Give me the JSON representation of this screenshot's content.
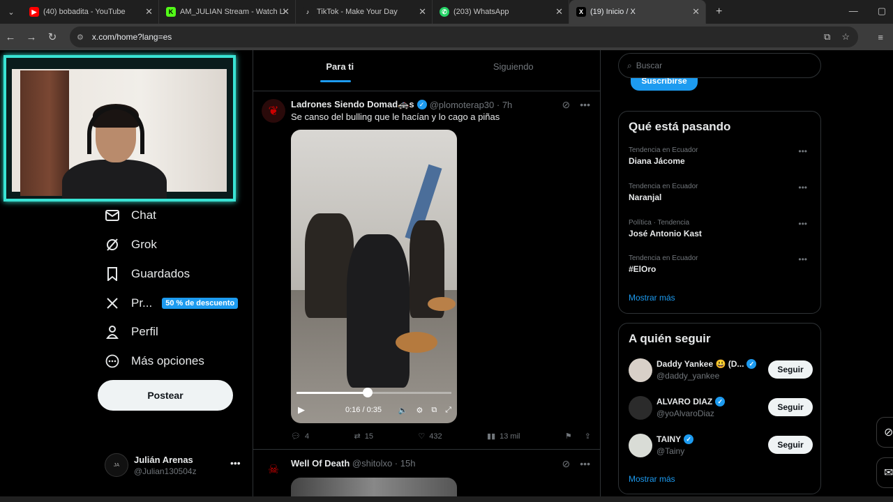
{
  "browser": {
    "tabs": [
      {
        "title": "(40) bobadita - YouTube",
        "icon": "youtube-icon",
        "color": "#ff0000",
        "glyph": "▶"
      },
      {
        "title": "AM_JULIAN Stream - Watch Live",
        "icon": "kick-icon",
        "color": "#53fc18",
        "glyph": "K"
      },
      {
        "title": "TikTok - Make Your Day",
        "icon": "tiktok-icon",
        "color": "#1f1f1f",
        "glyph": "♪"
      },
      {
        "title": "(203) WhatsApp",
        "icon": "whatsapp-icon",
        "color": "#25d366",
        "glyph": "✆"
      },
      {
        "title": "(19) Inicio / X",
        "icon": "x-icon",
        "color": "#000000",
        "glyph": "X"
      }
    ],
    "url": "x.com/home?lang=es"
  },
  "nav": {
    "items": [
      {
        "label": "Chat",
        "icon": "mail-icon"
      },
      {
        "label": "Grok",
        "icon": "grok-icon"
      },
      {
        "label": "Guardados",
        "icon": "bookmark-icon"
      },
      {
        "label": "Pr...",
        "icon": "x-premium-icon"
      },
      {
        "label": "Perfil",
        "icon": "person-icon"
      },
      {
        "label": "Más opciones",
        "icon": "more-circle-icon"
      }
    ],
    "promo_badge": "50 % de descuento",
    "post_button": "Postear",
    "account": {
      "name": "Julián Arenas",
      "handle": "@Julian130504z"
    }
  },
  "feed": {
    "tabs": [
      "Para ti",
      "Siguiendo"
    ],
    "tweets": [
      {
        "name": "Ladrones Siendo Domad🚓s",
        "handle": "@plomoterap30",
        "time": "7h",
        "text": "Se canso del bulling que le hacían y lo cago a piñas",
        "video": {
          "time": "0:16 / 0:35",
          "progress": 0.46
        },
        "replies": "4",
        "reposts": "15",
        "likes": "432",
        "views": "13 mil"
      },
      {
        "name": "Well Of Death",
        "handle": "@shitolxo",
        "time": "15h"
      }
    ]
  },
  "sidebar": {
    "search_placeholder": "Buscar",
    "subscribe_button": "Suscribirse",
    "trends_title": "Qué está pasando",
    "trends": [
      {
        "context": "Tendencia en Ecuador",
        "topic": "Diana Jácome"
      },
      {
        "context": "Tendencia en Ecuador",
        "topic": "Naranjal"
      },
      {
        "context": "Política · Tendencia",
        "topic": "José Antonio Kast"
      },
      {
        "context": "Tendencia en Ecuador",
        "topic": "#ElOro"
      }
    ],
    "show_more": "Mostrar más",
    "follow_title": "A quién seguir",
    "follow": [
      {
        "name": "Daddy Yankee 😃 (D...",
        "handle": "@daddy_yankee"
      },
      {
        "name": "ALVARO DIAZ",
        "handle": "@yoAlvaroDiaz"
      },
      {
        "name": "TAINY",
        "handle": "@Tainy"
      }
    ],
    "follow_button": "Seguir"
  },
  "colors": {
    "accent": "#1d9bf0",
    "webcam_frame": "#39e3d4"
  }
}
